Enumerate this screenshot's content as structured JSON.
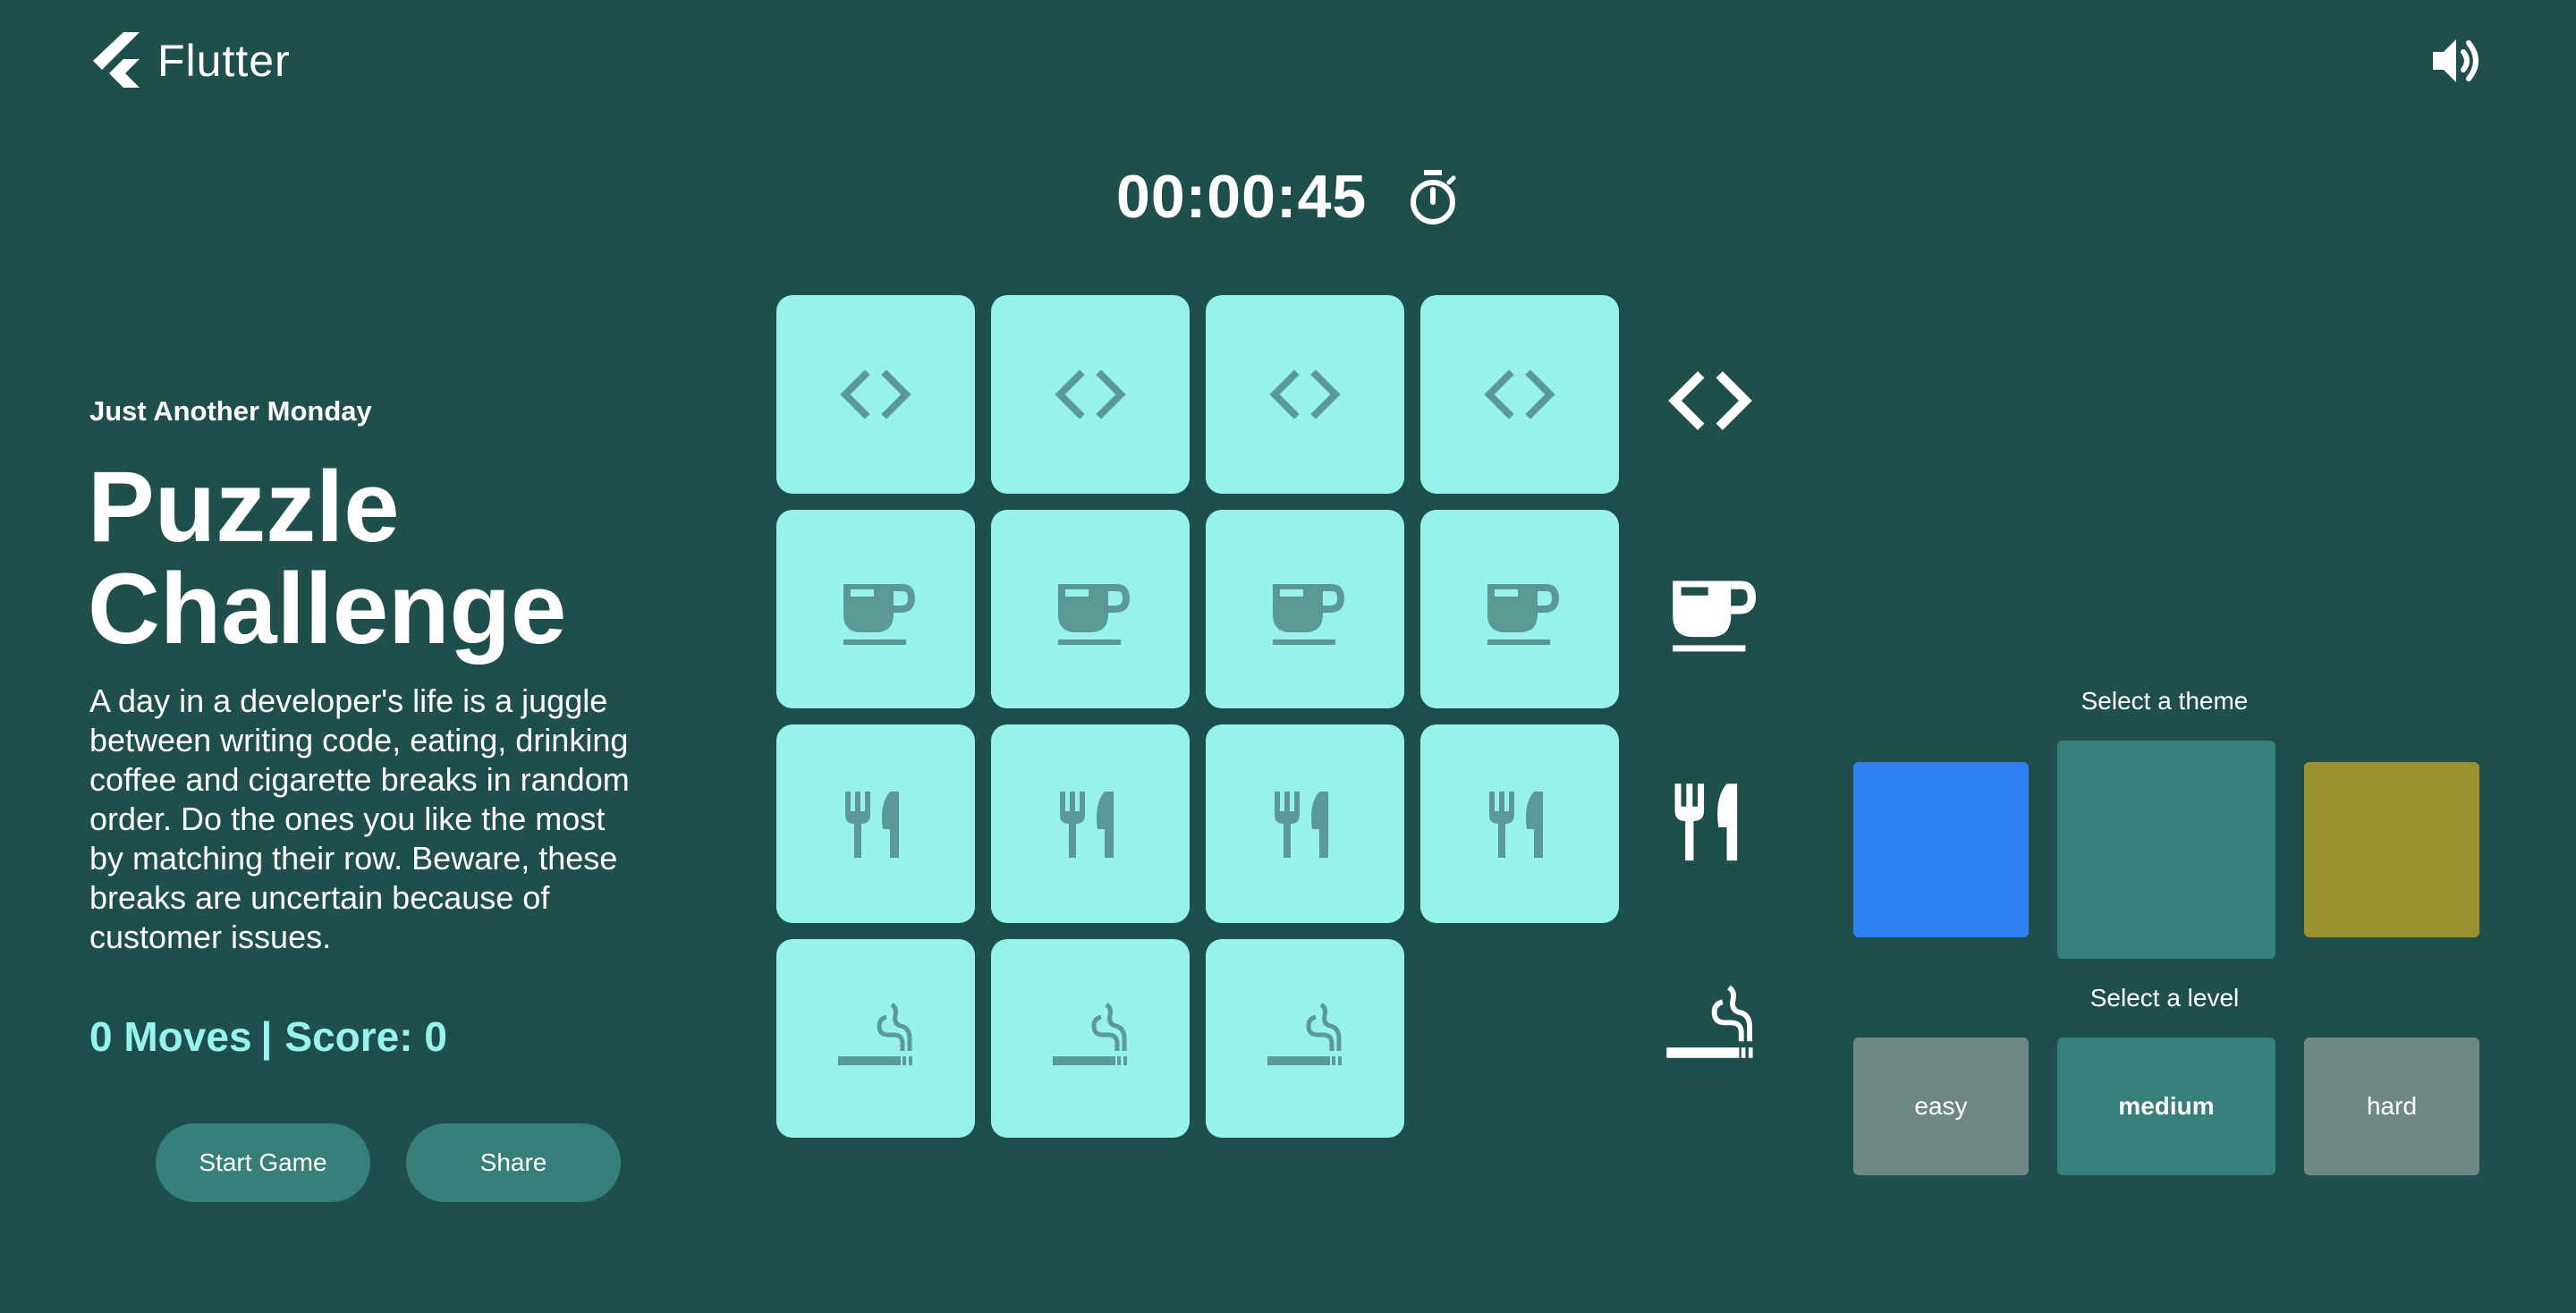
{
  "header": {
    "logo_text": "Flutter",
    "logo_icon": "flutter-logo-icon",
    "sound_icon": "volume-up-icon"
  },
  "timer": {
    "value": "00:00:45",
    "icon": "stopwatch-icon"
  },
  "intro": {
    "subtitle": "Just Another Monday",
    "title": "Puzzle Challenge",
    "description": "A day in a developer's life is a juggle between writing code, eating, drinking coffee and cigarette breaks in random order. Do the ones you like the most by matching their row. Beware, these breaks are uncertain because of customer issues."
  },
  "stats": {
    "moves": "0 Moves",
    "separator": "|",
    "score": "Score: 0"
  },
  "buttons": {
    "start": "Start Game",
    "share": "Share"
  },
  "board": {
    "rows": [
      {
        "icon": "code-icon",
        "tiles": 4
      },
      {
        "icon": "coffee-icon",
        "tiles": 4
      },
      {
        "icon": "restaurant-icon",
        "tiles": 4
      },
      {
        "icon": "smoking-icon",
        "tiles": 3
      }
    ],
    "empty_slot": "row-4-col-4"
  },
  "theme": {
    "label": "Select a theme",
    "options": [
      {
        "color": "#3180f2",
        "selected": false
      },
      {
        "color": "#377f79",
        "selected": true
      },
      {
        "color": "#9a9030",
        "selected": false
      }
    ]
  },
  "level": {
    "label": "Select a level",
    "options": [
      {
        "label": "easy",
        "selected": false
      },
      {
        "label": "medium",
        "selected": true
      },
      {
        "label": "hard",
        "selected": false
      }
    ]
  },
  "colors": {
    "background": "#1f4f4c",
    "tile": "#97f3ea",
    "tile_icon": "#5b9a94",
    "accent": "#98f3ea",
    "button": "#377f79",
    "level_unselected": "#6f8886"
  }
}
